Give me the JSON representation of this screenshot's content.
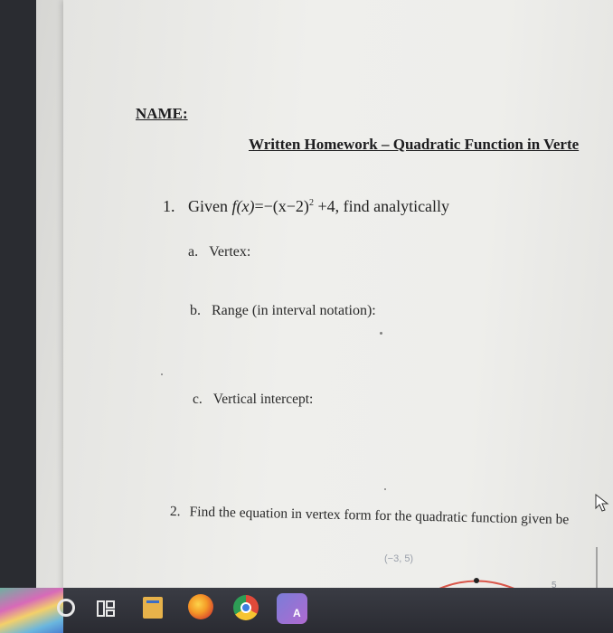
{
  "document": {
    "name_label": "NAME:",
    "title": "Written Homework – Quadratic Function in Verte",
    "q1": {
      "number": "1.",
      "lead": "Given",
      "func_lhs": "f(x)",
      "func_rhs": "=−(x−2)",
      "exponent": "2",
      "func_tail": "+4, find analytically"
    },
    "q1_parts": [
      {
        "letter": "a.",
        "text": "Vertex:"
      },
      {
        "letter": "b.",
        "text": "Range (in interval notation):"
      },
      {
        "letter": "c.",
        "text": "Vertical intercept:"
      }
    ],
    "q2": {
      "number": "2.",
      "text": "Find the equation in vertex form for the quadratic function given be"
    },
    "graph": {
      "point_label": "(−3, 5)",
      "axis_tick": "5"
    }
  },
  "taskbar": {
    "icons": [
      "start-icon",
      "search-icon",
      "taskview-icon",
      "file-explorer-icon",
      "firefox-icon",
      "chrome-icon",
      "app-icon"
    ]
  },
  "colors": {
    "paper": "#eeeeeb",
    "ink": "#1d1d1f",
    "curve": "#d9564a",
    "taskbar": "#2e3037"
  }
}
